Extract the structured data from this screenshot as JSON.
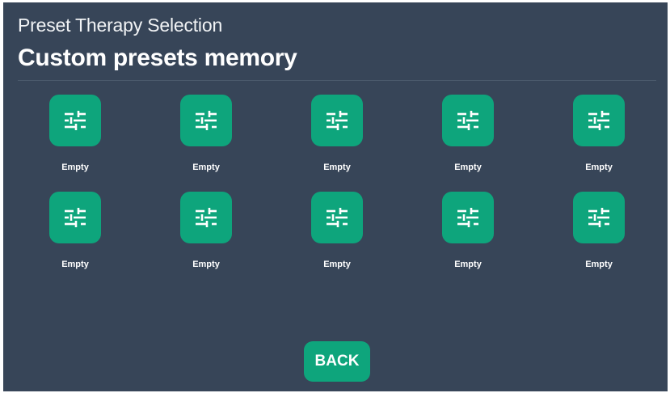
{
  "header": {
    "subtitle": "Preset Therapy Selection",
    "title": "Custom presets memory"
  },
  "presets": [
    {
      "label": "Empty",
      "icon": "tune-sliders-icon"
    },
    {
      "label": "Empty",
      "icon": "tune-sliders-icon"
    },
    {
      "label": "Empty",
      "icon": "tune-sliders-icon"
    },
    {
      "label": "Empty",
      "icon": "tune-sliders-icon"
    },
    {
      "label": "Empty",
      "icon": "tune-sliders-icon"
    },
    {
      "label": "Empty",
      "icon": "tune-sliders-icon"
    },
    {
      "label": "Empty",
      "icon": "tune-sliders-icon"
    },
    {
      "label": "Empty",
      "icon": "tune-sliders-icon"
    },
    {
      "label": "Empty",
      "icon": "tune-sliders-icon"
    },
    {
      "label": "Empty",
      "icon": "tune-sliders-icon"
    }
  ],
  "footer": {
    "back_label": "BACK"
  },
  "colors": {
    "background": "#374558",
    "accent": "#0ea57c",
    "text": "#ffffff"
  }
}
